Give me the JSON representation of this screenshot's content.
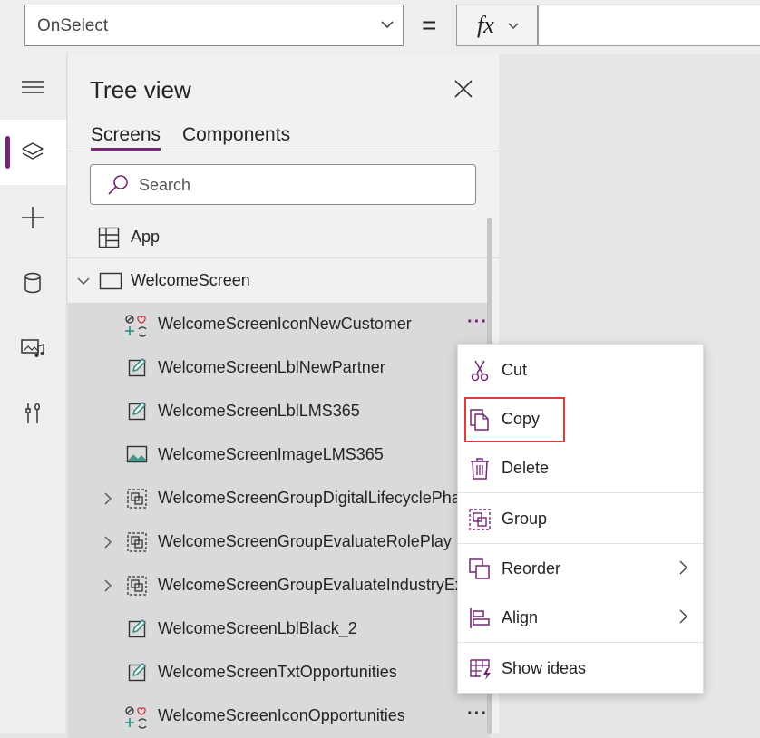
{
  "formula_bar": {
    "property": "OnSelect",
    "equals": "=",
    "fx_label": "fx",
    "formula": ""
  },
  "rail": {
    "items": [
      {
        "name": "menu-icon",
        "active": false
      },
      {
        "name": "layers-icon",
        "active": true
      },
      {
        "name": "plus-icon",
        "active": false
      },
      {
        "name": "database-icon",
        "active": false
      },
      {
        "name": "media-icon",
        "active": false
      },
      {
        "name": "tools-icon",
        "active": false
      }
    ]
  },
  "tree": {
    "title": "Tree view",
    "tabs": [
      "Screens",
      "Components"
    ],
    "active_tab": "Screens",
    "search_placeholder": "Search",
    "app_label": "App",
    "screen_label": "WelcomeScreen",
    "items": [
      {
        "label": "WelcomeScreenIconNewCustomer",
        "icon": "icon-control-icon",
        "selected": true,
        "expander": false
      },
      {
        "label": "WelcomeScreenLblNewPartner",
        "icon": "label-edit-icon",
        "selected": true,
        "expander": false
      },
      {
        "label": "WelcomeScreenLblLMS365",
        "icon": "label-edit-icon",
        "selected": true,
        "expander": false
      },
      {
        "label": "WelcomeScreenImageLMS365",
        "icon": "image-icon",
        "selected": true,
        "expander": false
      },
      {
        "label": "WelcomeScreenGroupDigitalLifecyclePhas",
        "icon": "group-icon",
        "selected": true,
        "expander": true
      },
      {
        "label": "WelcomeScreenGroupEvaluateRolePlay",
        "icon": "group-icon",
        "selected": true,
        "expander": true
      },
      {
        "label": "WelcomeScreenGroupEvaluateIndustryExp",
        "icon": "group-icon",
        "selected": true,
        "expander": true
      },
      {
        "label": "WelcomeScreenLblBlack_2",
        "icon": "label-edit-icon",
        "selected": true,
        "expander": false
      },
      {
        "label": "WelcomeScreenTxtOpportunities",
        "icon": "label-edit-icon",
        "selected": true,
        "expander": false
      },
      {
        "label": "WelcomeScreenIconOpportunities",
        "icon": "icon-control-icon",
        "selected": true,
        "expander": false
      }
    ],
    "more_label": "···"
  },
  "context_menu": {
    "items": [
      {
        "label": "Cut",
        "icon": "scissors-icon",
        "submenu": false
      },
      {
        "label": "Copy",
        "icon": "copy-icon",
        "submenu": false
      },
      {
        "label": "Delete",
        "icon": "trash-icon",
        "submenu": false
      },
      {
        "label": "Group",
        "icon": "group-icon",
        "submenu": false
      },
      {
        "label": "Reorder",
        "icon": "reorder-icon",
        "submenu": true
      },
      {
        "label": "Align",
        "icon": "align-icon",
        "submenu": true
      },
      {
        "label": "Show ideas",
        "icon": "ideas-icon",
        "submenu": false
      }
    ]
  },
  "colors": {
    "accent": "#742774",
    "highlight": "#e03c3c",
    "icon_teal": "#2b8a7e"
  }
}
